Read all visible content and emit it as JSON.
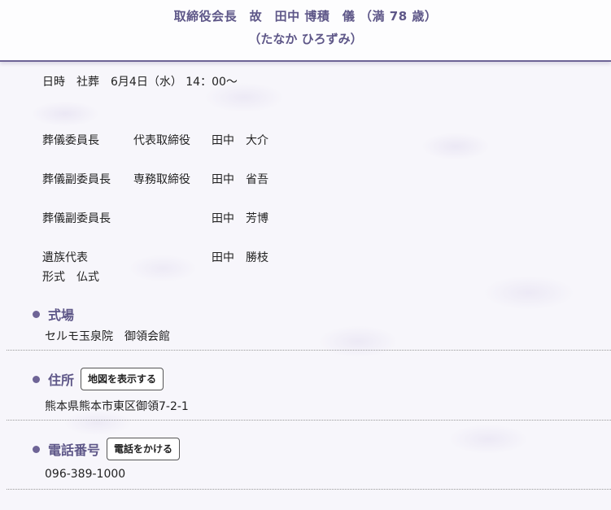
{
  "header": {
    "title": "取締役会長　故　田中 博積　儀 （満 78 歳）",
    "reading": "（たなか ひろずみ）"
  },
  "datetime": "日時　社葬　6月4日（水） 14：00～",
  "roles": [
    {
      "role": "葬儀委員長",
      "title": "代表取締役",
      "name": "田中　大介"
    },
    {
      "role": "葬儀副委員長",
      "title": "専務取締役",
      "name": "田中　省吾"
    },
    {
      "role": "葬儀副委員長",
      "title": "",
      "name": "田中　芳博"
    },
    {
      "role": "遺族代表",
      "title": "",
      "name": "田中　勝枝"
    }
  ],
  "form": "形式　仏式",
  "venue": {
    "label": "式場",
    "value": "セルモ玉泉院　御領会館"
  },
  "address": {
    "label": "住所",
    "button": "地図を表示する",
    "value": "熊本県熊本市東区御領7-2-1"
  },
  "phone": {
    "label": "電話番号",
    "button": "電話をかける",
    "value": "096-389-1000"
  },
  "colors": {
    "accent": "#5e5788",
    "rule": "#6e6496"
  }
}
